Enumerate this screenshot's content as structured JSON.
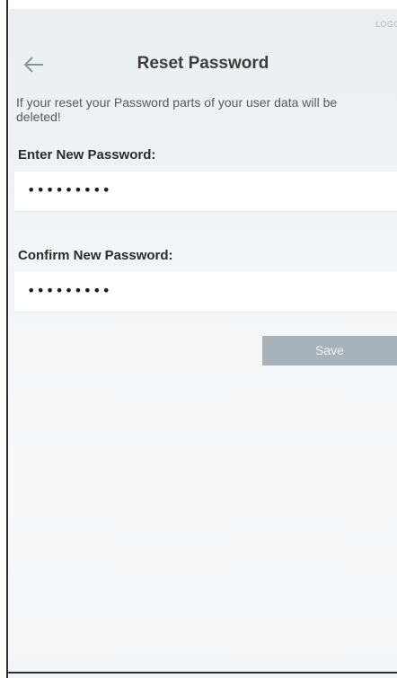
{
  "status_bar": {
    "corner_text": "LOGO"
  },
  "header": {
    "title": "Reset Password",
    "back_icon": "arrow-left-icon"
  },
  "warning": {
    "text": "If your reset your Password parts of your user data will be deleted!"
  },
  "form": {
    "new_password_label": "Enter New Password:",
    "new_password_value": "•••••••••",
    "confirm_password_label": "Confirm New Password:",
    "confirm_password_value": "•••••••••",
    "save_label": "Save"
  },
  "colors": {
    "background": "#eef2f5",
    "save_button": "#a7b2bb",
    "title_text": "#3c3c3c"
  }
}
